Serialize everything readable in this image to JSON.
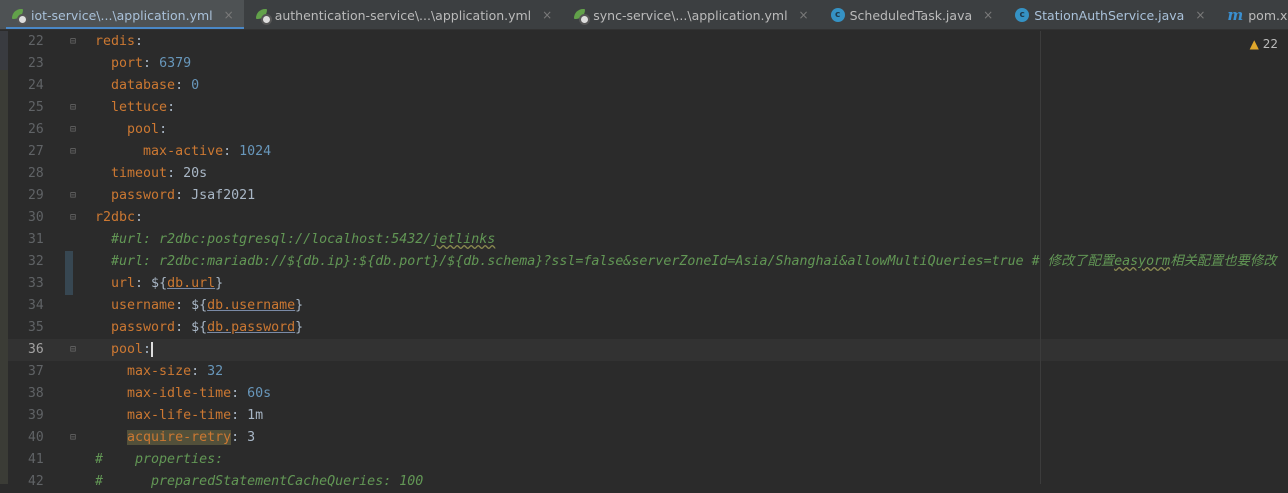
{
  "tabs": [
    {
      "label": "iot-service\\...\\application.yml",
      "icon": "spring-yml-icon",
      "active": true
    },
    {
      "label": "authentication-service\\...\\application.yml",
      "icon": "spring-yml-icon"
    },
    {
      "label": "sync-service\\...\\application.yml",
      "icon": "spring-yml-icon"
    },
    {
      "label": "ScheduledTask.java",
      "icon": "java-class-icon"
    },
    {
      "label": "StationAuthService.java",
      "icon": "java-class-icon",
      "blue": true
    },
    {
      "label": "pom.xml (file-service)",
      "icon": "maven-icon"
    },
    {
      "label": "p",
      "icon": "maven-icon"
    }
  ],
  "close_glyph": "×",
  "inspection": {
    "warning_count": "22"
  },
  "editor": {
    "current_line": 36,
    "lines": [
      {
        "n": "22",
        "fold": "open",
        "tokens": [
          {
            "t": "redis",
            "c": "k"
          },
          {
            "t": ":",
            "c": "p"
          }
        ]
      },
      {
        "n": "23",
        "tokens": [
          {
            "t": "  "
          },
          {
            "t": "port",
            "c": "k"
          },
          {
            "t": ": ",
            "c": "p"
          },
          {
            "t": "6379",
            "c": "n"
          }
        ]
      },
      {
        "n": "24",
        "tokens": [
          {
            "t": "  "
          },
          {
            "t": "database",
            "c": "k"
          },
          {
            "t": ": ",
            "c": "p"
          },
          {
            "t": "0",
            "c": "n"
          }
        ]
      },
      {
        "n": "25",
        "fold": "open",
        "tokens": [
          {
            "t": "  "
          },
          {
            "t": "lettuce",
            "c": "k"
          },
          {
            "t": ":",
            "c": "p"
          }
        ]
      },
      {
        "n": "26",
        "fold": "open",
        "tokens": [
          {
            "t": "    "
          },
          {
            "t": "pool",
            "c": "k"
          },
          {
            "t": ":",
            "c": "p"
          }
        ]
      },
      {
        "n": "27",
        "fold": "end",
        "tokens": [
          {
            "t": "      "
          },
          {
            "t": "max-active",
            "c": "k"
          },
          {
            "t": ": ",
            "c": "p"
          },
          {
            "t": "1024",
            "c": "n"
          }
        ]
      },
      {
        "n": "28",
        "tokens": [
          {
            "t": "  "
          },
          {
            "t": "timeout",
            "c": "k"
          },
          {
            "t": ": 20s",
            "c": "p"
          }
        ]
      },
      {
        "n": "29",
        "fold": "end",
        "tokens": [
          {
            "t": "  "
          },
          {
            "t": "password",
            "c": "k"
          },
          {
            "t": ": Jsaf2021",
            "c": "p"
          }
        ]
      },
      {
        "n": "30",
        "fold": "open",
        "tokens": [
          {
            "t": "r2dbc",
            "c": "k"
          },
          {
            "t": ":",
            "c": "p"
          }
        ]
      },
      {
        "n": "31",
        "tokens": [
          {
            "t": "  "
          },
          {
            "t": "#url: r2dbc:postgresql://localhost:5432/",
            "c": "c"
          },
          {
            "t": "jetlinks",
            "c": "c w"
          }
        ]
      },
      {
        "n": "32",
        "mark": true,
        "tokens": [
          {
            "t": "  "
          },
          {
            "t": "#url: r2dbc:mariadb://${db.ip}:${db.port}/${db.schema}?ssl=false&serverZoneId=Asia/Shanghai&allowMultiQueries=true # ",
            "c": "c"
          },
          {
            "t": "修改了配置",
            "c": "c"
          },
          {
            "t": "easyorm",
            "c": "c w"
          },
          {
            "t": "相关配置也要修改",
            "c": "c"
          }
        ]
      },
      {
        "n": "33",
        "mark": true,
        "tokens": [
          {
            "t": "  "
          },
          {
            "t": "url",
            "c": "k"
          },
          {
            "t": ": ${",
            "c": "p"
          },
          {
            "t": "db.url",
            "c": "k u"
          },
          {
            "t": "}",
            "c": "p"
          }
        ]
      },
      {
        "n": "34",
        "tokens": [
          {
            "t": "  "
          },
          {
            "t": "username",
            "c": "k"
          },
          {
            "t": ": ${",
            "c": "p"
          },
          {
            "t": "db.username",
            "c": "k u"
          },
          {
            "t": "}",
            "c": "p"
          }
        ]
      },
      {
        "n": "35",
        "tokens": [
          {
            "t": "  "
          },
          {
            "t": "password",
            "c": "k"
          },
          {
            "t": ": ${",
            "c": "p"
          },
          {
            "t": "db.password",
            "c": "k u"
          },
          {
            "t": "}",
            "c": "p"
          }
        ]
      },
      {
        "n": "36",
        "fold": "open",
        "tokens": [
          {
            "t": "  "
          },
          {
            "t": "pool",
            "c": "k"
          },
          {
            "t": ":",
            "c": "p caret"
          }
        ]
      },
      {
        "n": "37",
        "tokens": [
          {
            "t": "    "
          },
          {
            "t": "max-size",
            "c": "k"
          },
          {
            "t": ": ",
            "c": "p"
          },
          {
            "t": "32",
            "c": "n"
          }
        ]
      },
      {
        "n": "38",
        "tokens": [
          {
            "t": "    "
          },
          {
            "t": "max-idle-time",
            "c": "k"
          },
          {
            "t": ": ",
            "c": "p"
          },
          {
            "t": "60s",
            "c": "n"
          }
        ]
      },
      {
        "n": "39",
        "tokens": [
          {
            "t": "    "
          },
          {
            "t": "max-life-time",
            "c": "k"
          },
          {
            "t": ": 1m",
            "c": "p"
          }
        ]
      },
      {
        "n": "40",
        "fold": "end",
        "tokens": [
          {
            "t": "    "
          },
          {
            "t": "acquire-retry",
            "c": "k hl"
          },
          {
            "t": ": 3",
            "c": "p"
          }
        ]
      },
      {
        "n": "41",
        "tokens": [
          {
            "t": "#    properties:",
            "c": "c"
          }
        ]
      },
      {
        "n": "42",
        "tokens": [
          {
            "t": "#      preparedStatementCacheQueries: 100",
            "c": "c"
          }
        ]
      }
    ]
  }
}
